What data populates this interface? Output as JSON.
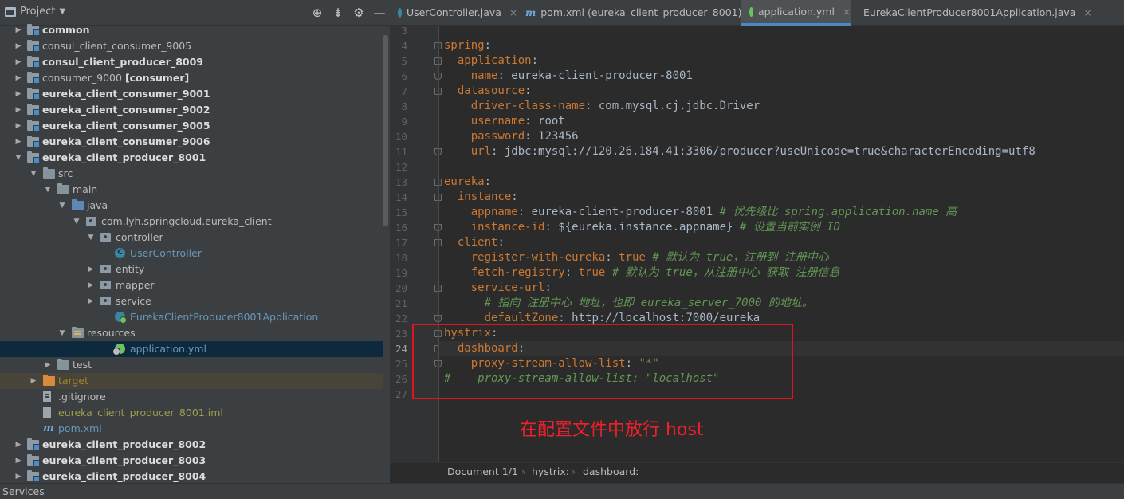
{
  "project_panel": {
    "title": "Project",
    "tools": [
      "⊕",
      "⇟",
      "⚙",
      "—"
    ],
    "tree": [
      {
        "depth": 0,
        "arrow": "▶",
        "icon": "folder-module",
        "label": "common",
        "bold": true
      },
      {
        "depth": 0,
        "arrow": "▶",
        "icon": "folder-module",
        "label": "consul_client_consumer_9005",
        "bold": false
      },
      {
        "depth": 0,
        "arrow": "▶",
        "icon": "folder-module",
        "label": "consul_client_producer_8009",
        "bold": true
      },
      {
        "depth": 0,
        "arrow": "▶",
        "icon": "folder-module",
        "label": "consumer_9000",
        "extra": "[consumer]",
        "bold": false
      },
      {
        "depth": 0,
        "arrow": "▶",
        "icon": "folder-module",
        "label": "eureka_client_consumer_9001",
        "bold": true
      },
      {
        "depth": 0,
        "arrow": "▶",
        "icon": "folder-module",
        "label": "eureka_client_consumer_9002",
        "bold": true
      },
      {
        "depth": 0,
        "arrow": "▶",
        "icon": "folder-module",
        "label": "eureka_client_consumer_9005",
        "bold": true
      },
      {
        "depth": 0,
        "arrow": "▶",
        "icon": "folder-module",
        "label": "eureka_client_consumer_9006",
        "bold": true
      },
      {
        "depth": 0,
        "arrow": "▼",
        "icon": "folder-module",
        "label": "eureka_client_producer_8001",
        "bold": true
      },
      {
        "depth": 1,
        "arrow": "▼",
        "icon": "folder-src",
        "label": "src"
      },
      {
        "depth": 2,
        "arrow": "▼",
        "icon": "folder-src",
        "label": "main"
      },
      {
        "depth": 3,
        "arrow": "▼",
        "icon": "folder-java",
        "label": "java"
      },
      {
        "depth": 4,
        "arrow": "▼",
        "icon": "package",
        "label": "com.lyh.springcloud.eureka_client"
      },
      {
        "depth": 5,
        "arrow": "▼",
        "icon": "package",
        "label": "controller"
      },
      {
        "depth": 6,
        "arrow": "",
        "icon": "class",
        "label": "UserController",
        "color": "blue"
      },
      {
        "depth": 5,
        "arrow": "▶",
        "icon": "package",
        "label": "entity"
      },
      {
        "depth": 5,
        "arrow": "▶",
        "icon": "package",
        "label": "mapper"
      },
      {
        "depth": 5,
        "arrow": "▶",
        "icon": "package",
        "label": "service"
      },
      {
        "depth": 5,
        "arrow": "",
        "icon": "spring-class",
        "label": "EurekaClientProducer8001Application",
        "color": "blue"
      },
      {
        "depth": 3,
        "arrow": "▼",
        "icon": "folder-res",
        "label": "resources"
      },
      {
        "depth": 5,
        "arrow": "",
        "icon": "yml",
        "label": "application.yml",
        "color": "blue",
        "selected": true
      },
      {
        "depth": 2,
        "arrow": "▶",
        "icon": "folder-src",
        "label": "test"
      },
      {
        "depth": 1,
        "arrow": "▶",
        "icon": "folder-orange",
        "label": "target",
        "color": "ylw",
        "excluded": true
      },
      {
        "depth": 1,
        "arrow": "",
        "icon": "file",
        "label": ".gitignore"
      },
      {
        "depth": 1,
        "arrow": "",
        "icon": "iml",
        "label": "eureka_client_producer_8001.iml",
        "color": "olive"
      },
      {
        "depth": 1,
        "arrow": "",
        "icon": "maven",
        "label": "pom.xml",
        "color": "blue"
      },
      {
        "depth": 0,
        "arrow": "▶",
        "icon": "folder-module",
        "label": "eureka_client_producer_8002",
        "bold": true
      },
      {
        "depth": 0,
        "arrow": "▶",
        "icon": "folder-module",
        "label": "eureka_client_producer_8003",
        "bold": true
      },
      {
        "depth": 0,
        "arrow": "▶",
        "icon": "folder-module",
        "label": "eureka_client_producer_8004",
        "bold": true
      }
    ]
  },
  "tabs": [
    {
      "label": "UserController.java",
      "icon": "class"
    },
    {
      "label": "pom.xml (eureka_client_producer_8001)",
      "icon": "maven"
    },
    {
      "label": "application.yml",
      "icon": "yml",
      "active": true
    },
    {
      "label": "EurekaClientProducer8001Application.java",
      "icon": "spring-class"
    }
  ],
  "tab_close": "×",
  "editor": {
    "current_line": 24,
    "lines": [
      {
        "n": 3,
        "parts": []
      },
      {
        "n": 4,
        "fold": "open",
        "parts": [
          [
            "k",
            "spring"
          ],
          [
            "v",
            ":"
          ]
        ]
      },
      {
        "n": 5,
        "fold": "open",
        "parts": [
          [
            "v",
            "  "
          ],
          [
            "k",
            "application"
          ],
          [
            "v",
            ":"
          ]
        ]
      },
      {
        "n": 6,
        "fold": "close",
        "parts": [
          [
            "v",
            "    "
          ],
          [
            "k",
            "name"
          ],
          [
            "v",
            ": eureka-client-producer-8001"
          ]
        ]
      },
      {
        "n": 7,
        "fold": "open",
        "parts": [
          [
            "v",
            "  "
          ],
          [
            "k",
            "datasource"
          ],
          [
            "v",
            ":"
          ]
        ]
      },
      {
        "n": 8,
        "parts": [
          [
            "v",
            "    "
          ],
          [
            "k",
            "driver-class-name"
          ],
          [
            "v",
            ": com.mysql.cj.jdbc.Driver"
          ]
        ]
      },
      {
        "n": 9,
        "parts": [
          [
            "v",
            "    "
          ],
          [
            "k",
            "username"
          ],
          [
            "v",
            ": root"
          ]
        ]
      },
      {
        "n": 10,
        "parts": [
          [
            "v",
            "    "
          ],
          [
            "k",
            "password"
          ],
          [
            "v",
            ": 123456"
          ]
        ]
      },
      {
        "n": 11,
        "fold": "close",
        "parts": [
          [
            "v",
            "    "
          ],
          [
            "k",
            "url"
          ],
          [
            "v",
            ": jdbc:mysql://120.26.184.41:3306/producer?useUnicode=true&characterEncoding=utf8"
          ]
        ]
      },
      {
        "n": 12,
        "parts": []
      },
      {
        "n": 13,
        "fold": "open",
        "parts": [
          [
            "k",
            "eureka"
          ],
          [
            "v",
            ":"
          ]
        ]
      },
      {
        "n": 14,
        "fold": "open",
        "parts": [
          [
            "v",
            "  "
          ],
          [
            "k",
            "instance"
          ],
          [
            "v",
            ":"
          ]
        ]
      },
      {
        "n": 15,
        "parts": [
          [
            "v",
            "    "
          ],
          [
            "k",
            "appname"
          ],
          [
            "v",
            ": eureka-client-producer-8001 "
          ],
          [
            "c",
            "# 优先级比 spring.application.name 高"
          ]
        ]
      },
      {
        "n": 16,
        "fold": "close",
        "parts": [
          [
            "v",
            "    "
          ],
          [
            "k",
            "instance-id"
          ],
          [
            "v",
            ": ${eureka.instance.appname} "
          ],
          [
            "c",
            "# 设置当前实例 ID"
          ]
        ]
      },
      {
        "n": 17,
        "fold": "open",
        "parts": [
          [
            "v",
            "  "
          ],
          [
            "k",
            "client"
          ],
          [
            "v",
            ":"
          ]
        ]
      },
      {
        "n": 18,
        "parts": [
          [
            "v",
            "    "
          ],
          [
            "k",
            "register-with-eureka"
          ],
          [
            "v",
            ": "
          ],
          [
            "k",
            "true"
          ],
          [
            "v",
            " "
          ],
          [
            "c",
            "# 默认为 true，注册到 注册中心"
          ]
        ]
      },
      {
        "n": 19,
        "parts": [
          [
            "v",
            "    "
          ],
          [
            "k",
            "fetch-registry"
          ],
          [
            "v",
            ": "
          ],
          [
            "k",
            "true"
          ],
          [
            "v",
            " "
          ],
          [
            "c",
            "# 默认为 true，从注册中心 获取 注册信息"
          ]
        ]
      },
      {
        "n": 20,
        "fold": "open",
        "parts": [
          [
            "v",
            "    "
          ],
          [
            "k",
            "service-url"
          ],
          [
            "v",
            ":"
          ]
        ]
      },
      {
        "n": 21,
        "parts": [
          [
            "v",
            "      "
          ],
          [
            "c",
            "# 指向 注册中心 地址，也即 eureka_server_7000 的地址。"
          ]
        ]
      },
      {
        "n": 22,
        "fold": "close",
        "parts": [
          [
            "v",
            "      "
          ],
          [
            "k",
            "defaultZone"
          ],
          [
            "v",
            ": http://localhost:7000/eureka"
          ]
        ]
      },
      {
        "n": 23,
        "fold": "open",
        "parts": [
          [
            "k",
            "hystrix"
          ],
          [
            "v",
            ":"
          ]
        ]
      },
      {
        "n": 24,
        "fold": "open",
        "parts": [
          [
            "v",
            "  "
          ],
          [
            "k",
            "dashboard"
          ],
          [
            "v",
            ":"
          ]
        ]
      },
      {
        "n": 25,
        "fold": "close",
        "parts": [
          [
            "v",
            "    "
          ],
          [
            "k",
            "proxy-stream-allow-list"
          ],
          [
            "v",
            ": "
          ],
          [
            "s",
            "\"*\""
          ]
        ]
      },
      {
        "n": 26,
        "parts": [
          [
            "c",
            "#    proxy-stream-allow-list: \"localhost\""
          ]
        ]
      },
      {
        "n": 27,
        "parts": []
      }
    ]
  },
  "annotation": {
    "text": "在配置文件中放行 host",
    "color": "#e0141e"
  },
  "breadcrumb": {
    "doc": "Document 1/1",
    "items": [
      "hystrix:",
      "dashboard:"
    ],
    "sep": "›"
  },
  "statusbar": {
    "label": "Services"
  },
  "colors": {
    "keyword": "#cc7832",
    "comment": "#629755",
    "string": "#6a8759",
    "text": "#a9b7c6",
    "selected_row": "#0d293e"
  }
}
